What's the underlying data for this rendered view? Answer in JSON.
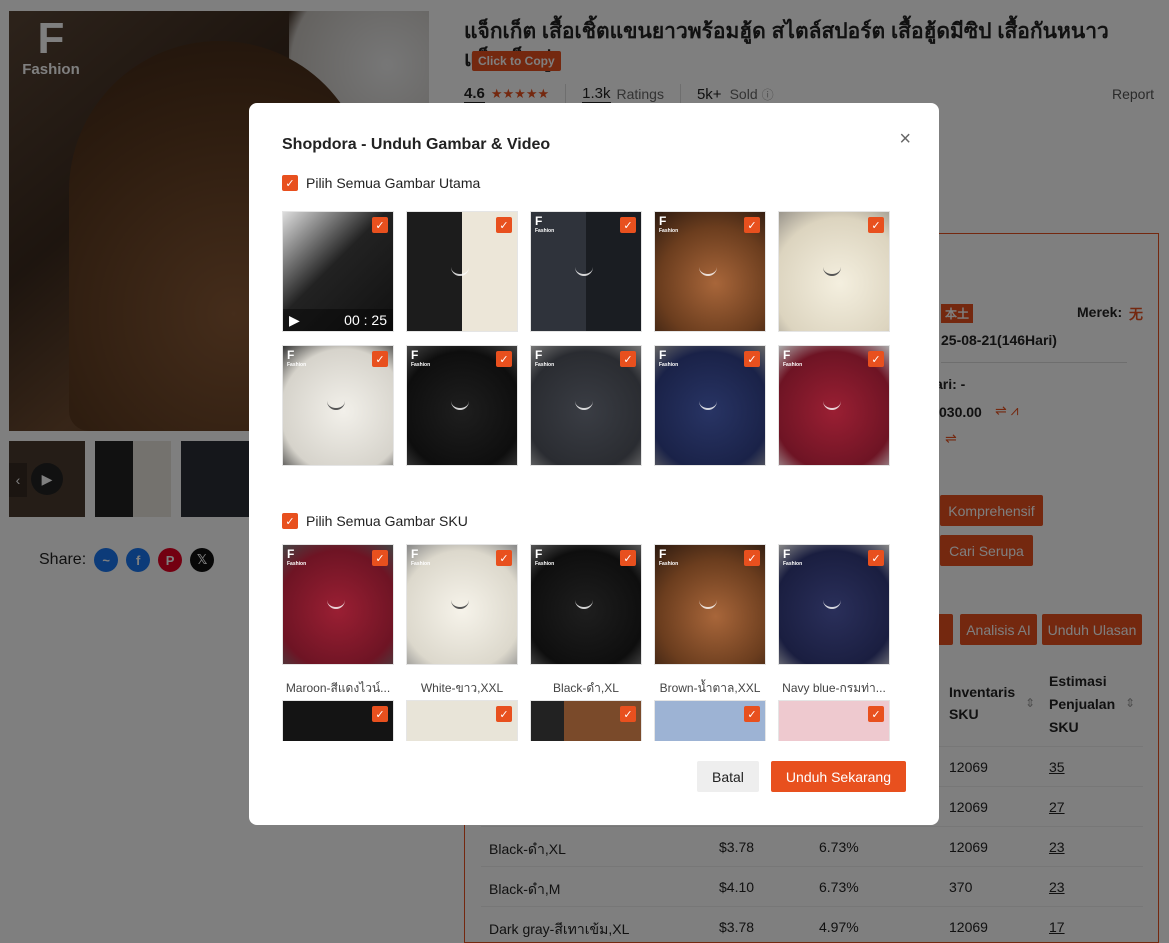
{
  "product": {
    "title": "แจ็กเก็ต เสื้อเชิ้ตแขนยาวพร้อมฮู้ด สไตล์สปอร์ต เสื้อฮู้ดมีซิป เสื้อกันหนาว แจ็คเก็ตคู่",
    "copy_label": "Click to Copy",
    "rating": "4.6",
    "ratings_count": "1.3k",
    "ratings_label": "Ratings",
    "sold_count": "5k+",
    "sold_label": "Sold",
    "report_label": "Report",
    "logo_letter": "F",
    "logo_text": "Fashion"
  },
  "share": {
    "label": "Share:",
    "icons": [
      "messenger-icon",
      "facebook-icon",
      "pinterest-icon",
      "x-icon"
    ]
  },
  "panel": {
    "brand_label": "Merek:",
    "brand_value": "无",
    "origin_badge": "本土",
    "date_text": "25-08-21(146Hari)",
    "hari_text": "ari: -",
    "price_text": "030.00",
    "btn_comprehensive": "Komprehensif",
    "btn_similar": "Cari Serupa",
    "btn_ai": "Analisis AI",
    "btn_reviews": "Unduh Ulasan",
    "col_inventory": "Inventaris SKU",
    "col_estimate": "Estimasi Penjualan SKU",
    "rows": [
      {
        "name": "",
        "price": "",
        "pct": "",
        "inv": "12069",
        "est": "35"
      },
      {
        "name": "",
        "price": "",
        "pct": "",
        "inv": "12069",
        "est": "27"
      },
      {
        "name": "Black-ดำ,XL",
        "price": "$3.78",
        "pct": "6.73%",
        "inv": "12069",
        "est": "23"
      },
      {
        "name": "Black-ดำ,M",
        "price": "$4.10",
        "pct": "6.73%",
        "inv": "370",
        "est": "23"
      },
      {
        "name": "Dark gray-สีเทาเข้ม,XL",
        "price": "$3.78",
        "pct": "4.97%",
        "inv": "12069",
        "est": "17"
      }
    ]
  },
  "modal": {
    "title": "Shopdora - Unduh Gambar & Video",
    "select_main_label": "Pilih Semua Gambar Utama",
    "select_sku_label": "Pilih Semua Gambar SKU",
    "video_time": "00 : 25",
    "sku_captions": [
      "Maroon-สีแดงไวน์...",
      "White-ขาว,XXL",
      "Black-ดำ,XL",
      "Brown-น้ำตาล,XXL",
      "Navy blue-กรมท่า..."
    ],
    "cancel_label": "Batal",
    "download_label": "Unduh Sekarang"
  },
  "colors": {
    "accent": "#e8501e"
  }
}
